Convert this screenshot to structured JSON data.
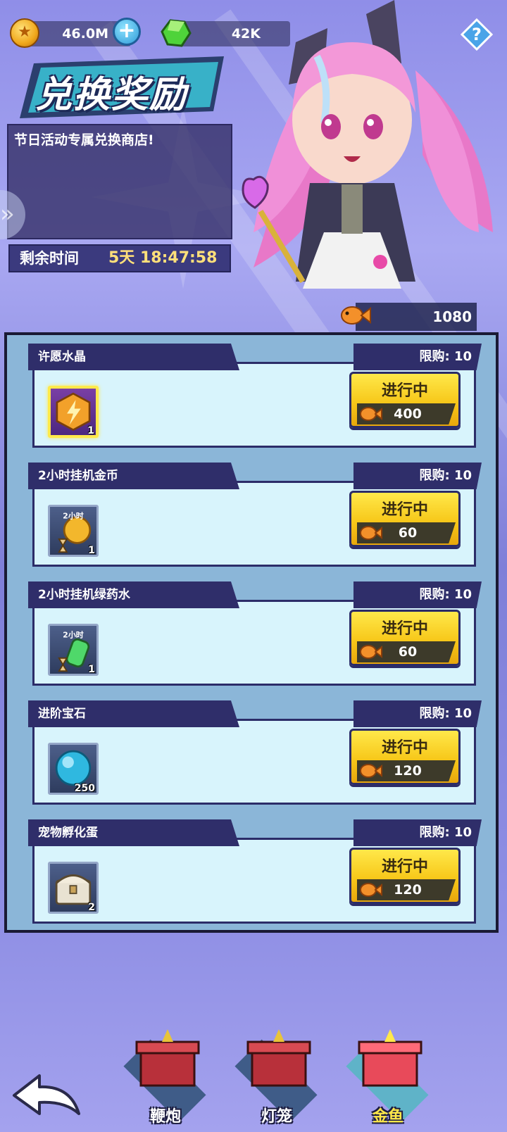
{
  "currency": {
    "coins": "46.0M",
    "gems": "42K",
    "fish": "1080"
  },
  "title": "兑换奖励",
  "description": "节日活动专属兑换商店!",
  "timer": {
    "label": "剩余时间",
    "value": "5天 18:47:58"
  },
  "items": [
    {
      "name": "许愿水晶",
      "limit": "限购: 10",
      "qty": "1",
      "status": "进行中",
      "price": "400",
      "icon": "lightning-crystal-icon"
    },
    {
      "name": "2小时挂机金币",
      "limit": "限购: 10",
      "qty": "1",
      "status": "进行中",
      "price": "60",
      "icon": "idle-coin-icon",
      "badge": "2小时"
    },
    {
      "name": "2小时挂机绿药水",
      "limit": "限购: 10",
      "qty": "1",
      "status": "进行中",
      "price": "60",
      "icon": "idle-potion-icon",
      "badge": "2小时"
    },
    {
      "name": "进阶宝石",
      "limit": "限购: 10",
      "qty": "250",
      "status": "进行中",
      "price": "120",
      "icon": "blue-gem-icon"
    },
    {
      "name": "宠物孵化蛋",
      "limit": "限购: 10",
      "qty": "2",
      "status": "进行中",
      "price": "120",
      "icon": "treasure-chest-icon"
    }
  ],
  "tabs": [
    {
      "label": "鞭炮"
    },
    {
      "label": "灯笼"
    },
    {
      "label": "金鱼"
    }
  ],
  "colors": {
    "accent_yellow": "#ffe84a",
    "panel_navy": "#2f2e6a",
    "card_bg": "#d8f4fc"
  }
}
